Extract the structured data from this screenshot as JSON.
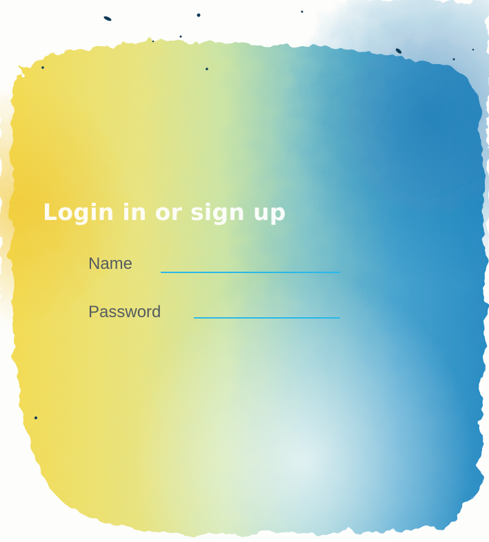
{
  "login_form": {
    "title": "Login in or sign up",
    "name_label": "Name",
    "name_value": "",
    "password_label": "Password",
    "password_value": ""
  },
  "colors": {
    "field_underline": "#29b8e8",
    "label_text": "#555c60",
    "title_text": "#ffffff",
    "watercolor_yellow": "#f2d94a",
    "watercolor_blue": "#1e86c0"
  }
}
